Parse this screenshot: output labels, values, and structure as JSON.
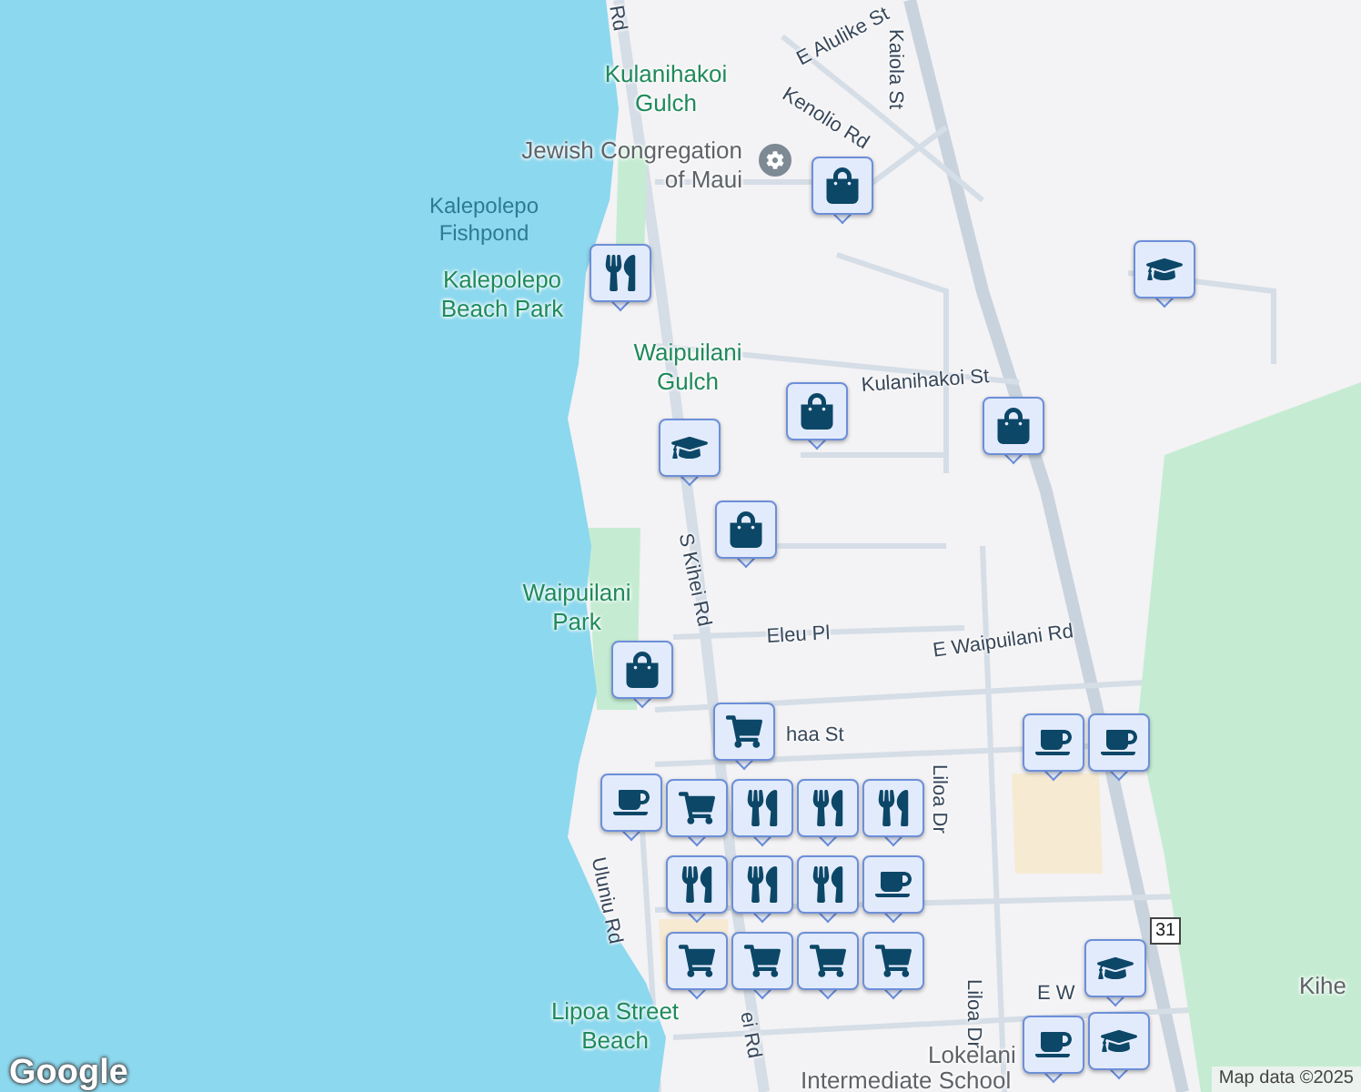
{
  "labels": [
    {
      "kind": "street",
      "text": "Rd"
    },
    {
      "kind": "street",
      "text": "E Alulike St"
    },
    {
      "kind": "street",
      "text": "Kaiola St"
    },
    {
      "kind": "street",
      "text": "Kenolio Rd"
    },
    {
      "kind": "park",
      "text": "Kulanihakoi Gulch"
    },
    {
      "kind": "poi",
      "text": "Jewish Congregation of Maui"
    },
    {
      "kind": "water",
      "text": "Kalepolepo Fishpond"
    },
    {
      "kind": "park",
      "text": "Kalepolepo Beach Park"
    },
    {
      "kind": "park",
      "text": "Waipuilani Gulch"
    },
    {
      "kind": "street",
      "text": "Kulanihakoi St"
    },
    {
      "kind": "street",
      "text": "S Kihei Rd"
    },
    {
      "kind": "park",
      "text": "Waipuilani Park"
    },
    {
      "kind": "street",
      "text": "Eleu Pl"
    },
    {
      "kind": "street",
      "text": "E Waipuilani Rd"
    },
    {
      "kind": "street",
      "text": "haa St"
    },
    {
      "kind": "street",
      "text": "Liloa Dr"
    },
    {
      "kind": "street",
      "text": "Uluniu Rd"
    },
    {
      "kind": "street",
      "text": "Liloa Dr"
    },
    {
      "kind": "street",
      "text": "E W"
    },
    {
      "kind": "poi",
      "text": "Kihe"
    },
    {
      "kind": "park",
      "text": "Lipoa Street Beach"
    },
    {
      "kind": "street",
      "text": "ei Rd"
    },
    {
      "kind": "poi",
      "text": "Lokelani"
    },
    {
      "kind": "poi",
      "text": "Intermediate School"
    }
  ],
  "route_shield": "31",
  "pins": [
    {
      "kind": "bag"
    },
    {
      "kind": "food"
    },
    {
      "kind": "school"
    },
    {
      "kind": "bag"
    },
    {
      "kind": "school"
    },
    {
      "kind": "bag"
    },
    {
      "kind": "bag"
    },
    {
      "kind": "bag"
    },
    {
      "kind": "cart"
    },
    {
      "kind": "cafe"
    },
    {
      "kind": "cafe"
    },
    {
      "kind": "cart"
    },
    {
      "kind": "food"
    },
    {
      "kind": "food"
    },
    {
      "kind": "food"
    },
    {
      "kind": "food"
    },
    {
      "kind": "food"
    },
    {
      "kind": "food"
    },
    {
      "kind": "cafe"
    },
    {
      "kind": "cart"
    },
    {
      "kind": "cart"
    },
    {
      "kind": "cart"
    },
    {
      "kind": "cart"
    },
    {
      "kind": "cafe"
    },
    {
      "kind": "school"
    },
    {
      "kind": "school"
    },
    {
      "kind": "cafe"
    }
  ],
  "logo": "Google",
  "attribution": "Map data ©2025"
}
